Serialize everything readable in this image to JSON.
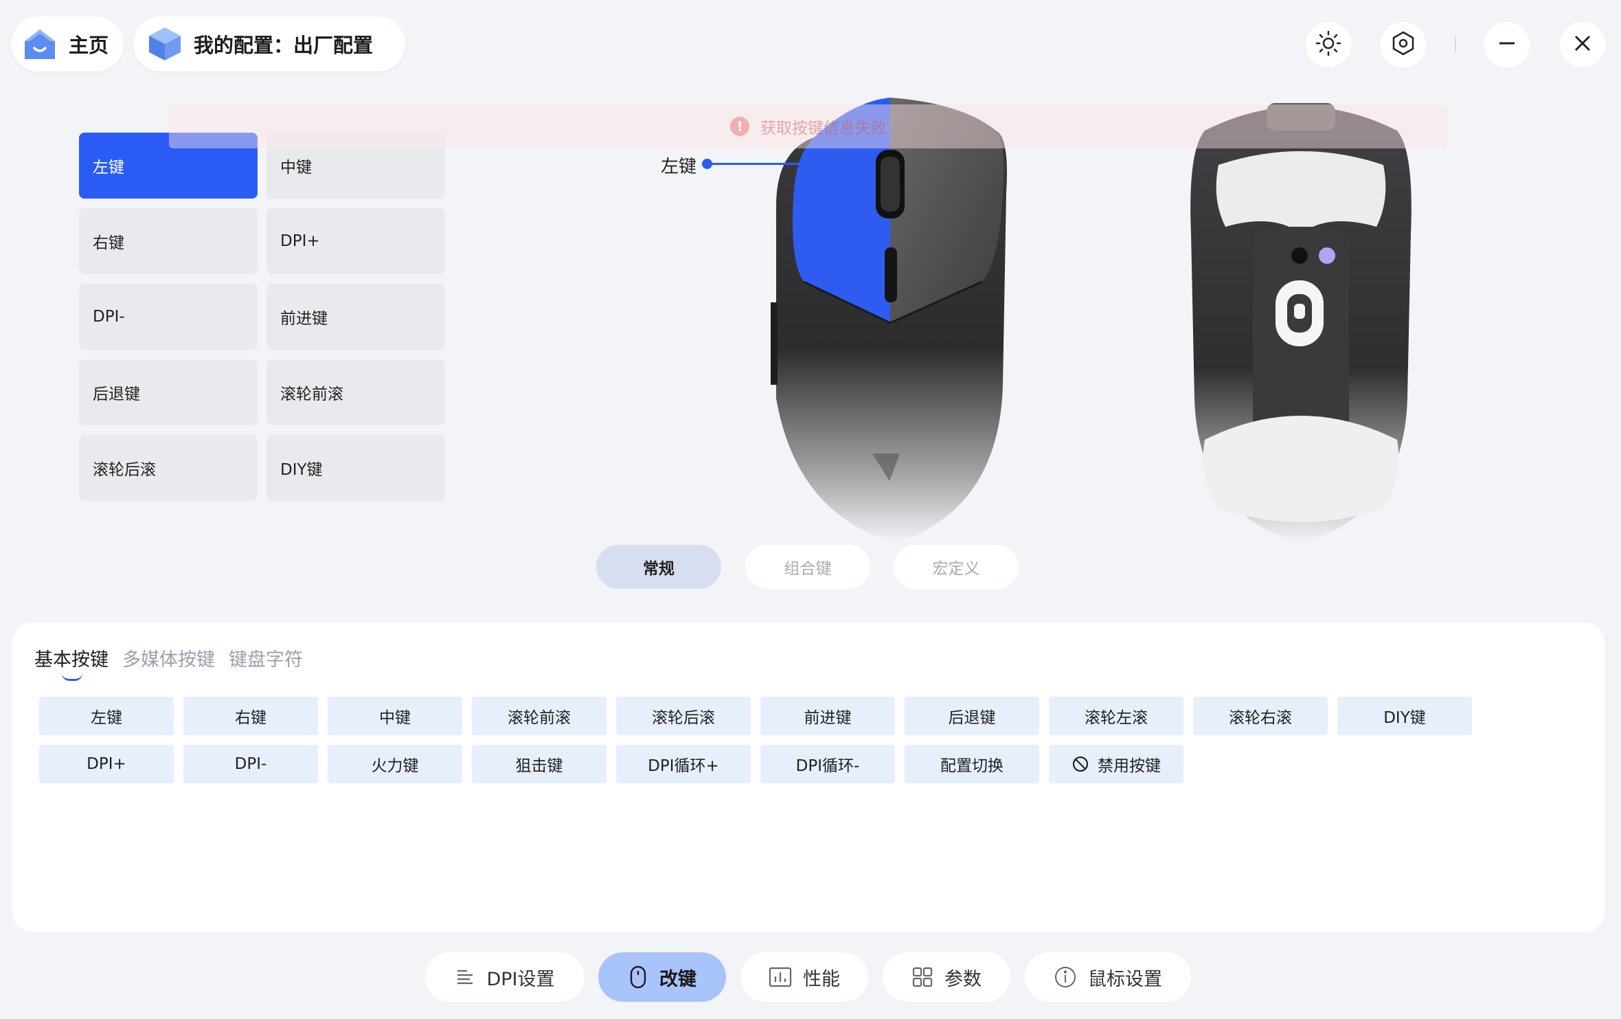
{
  "header": {
    "home_label": "主页",
    "config_label": "我的配置：出厂配置"
  },
  "toast": {
    "message": "获取按键信息失败"
  },
  "keys": [
    {
      "label": "左键",
      "active": true
    },
    {
      "label": "中键"
    },
    {
      "label": "右键"
    },
    {
      "label": "DPI+"
    },
    {
      "label": "DPI-"
    },
    {
      "label": "前进键"
    },
    {
      "label": "后退键"
    },
    {
      "label": "滚轮前滚"
    },
    {
      "label": "滚轮后滚"
    },
    {
      "label": "DIY键"
    }
  ],
  "callout": {
    "label": "左键"
  },
  "mode_tabs": [
    "常规",
    "组合键",
    "宏定义"
  ],
  "panel": {
    "subtabs": [
      "基本按键",
      "多媒体按键",
      "键盘字符"
    ],
    "functions": [
      "左键",
      "右键",
      "中键",
      "滚轮前滚",
      "滚轮后滚",
      "前进键",
      "后退键",
      "滚轮左滚",
      "滚轮右滚",
      "DIY键",
      "DPI+",
      "DPI-",
      "火力键",
      "狙击键",
      "DPI循环+",
      "DPI循环-",
      "配置切换",
      "禁用按键"
    ]
  },
  "nav": {
    "dpi": "DPI设置",
    "remap": "改键",
    "perf": "性能",
    "params": "参数",
    "mouse": "鼠标设置"
  },
  "colors": {
    "accent": "#2a5cf5",
    "nav_active": "#a9c3fb"
  },
  "icons": [
    "home-icon",
    "cube-icon",
    "sun-icon",
    "settings-hex-icon",
    "minimize-icon",
    "close-icon",
    "error-icon",
    "ban-icon",
    "dpi-icon",
    "mouse-icon",
    "chart-icon",
    "grid-icon",
    "info-icon"
  ]
}
